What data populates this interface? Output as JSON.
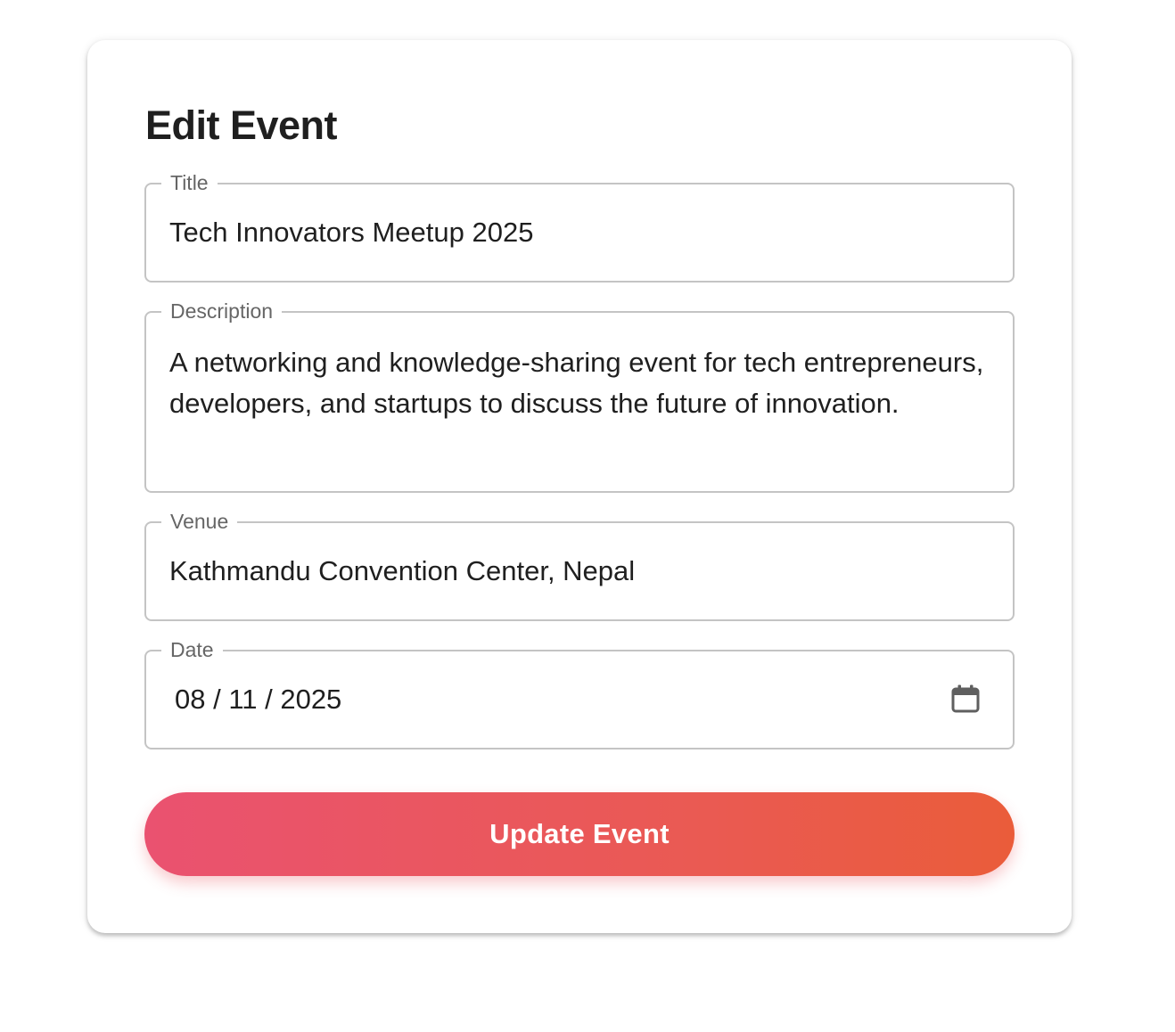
{
  "form": {
    "heading": "Edit Event",
    "fields": {
      "title": {
        "label": "Title",
        "value": "Tech Innovators Meetup 2025"
      },
      "description": {
        "label": "Description",
        "value": "A networking and knowledge-sharing event for tech entrepreneurs, developers, and startups to discuss the future of innovation."
      },
      "venue": {
        "label": "Venue",
        "value": "Kathmandu Convention Center, Nepal"
      },
      "date": {
        "label": "Date",
        "value": "08 / 11 / 2025",
        "icon": "calendar-icon"
      }
    },
    "submit_label": "Update Event"
  },
  "colors": {
    "button_gradient_start": "#ea5270",
    "button_gradient_end": "#ea5c3a",
    "border": "#c4c4c4",
    "label": "#666666",
    "text": "#1f1f1f"
  }
}
